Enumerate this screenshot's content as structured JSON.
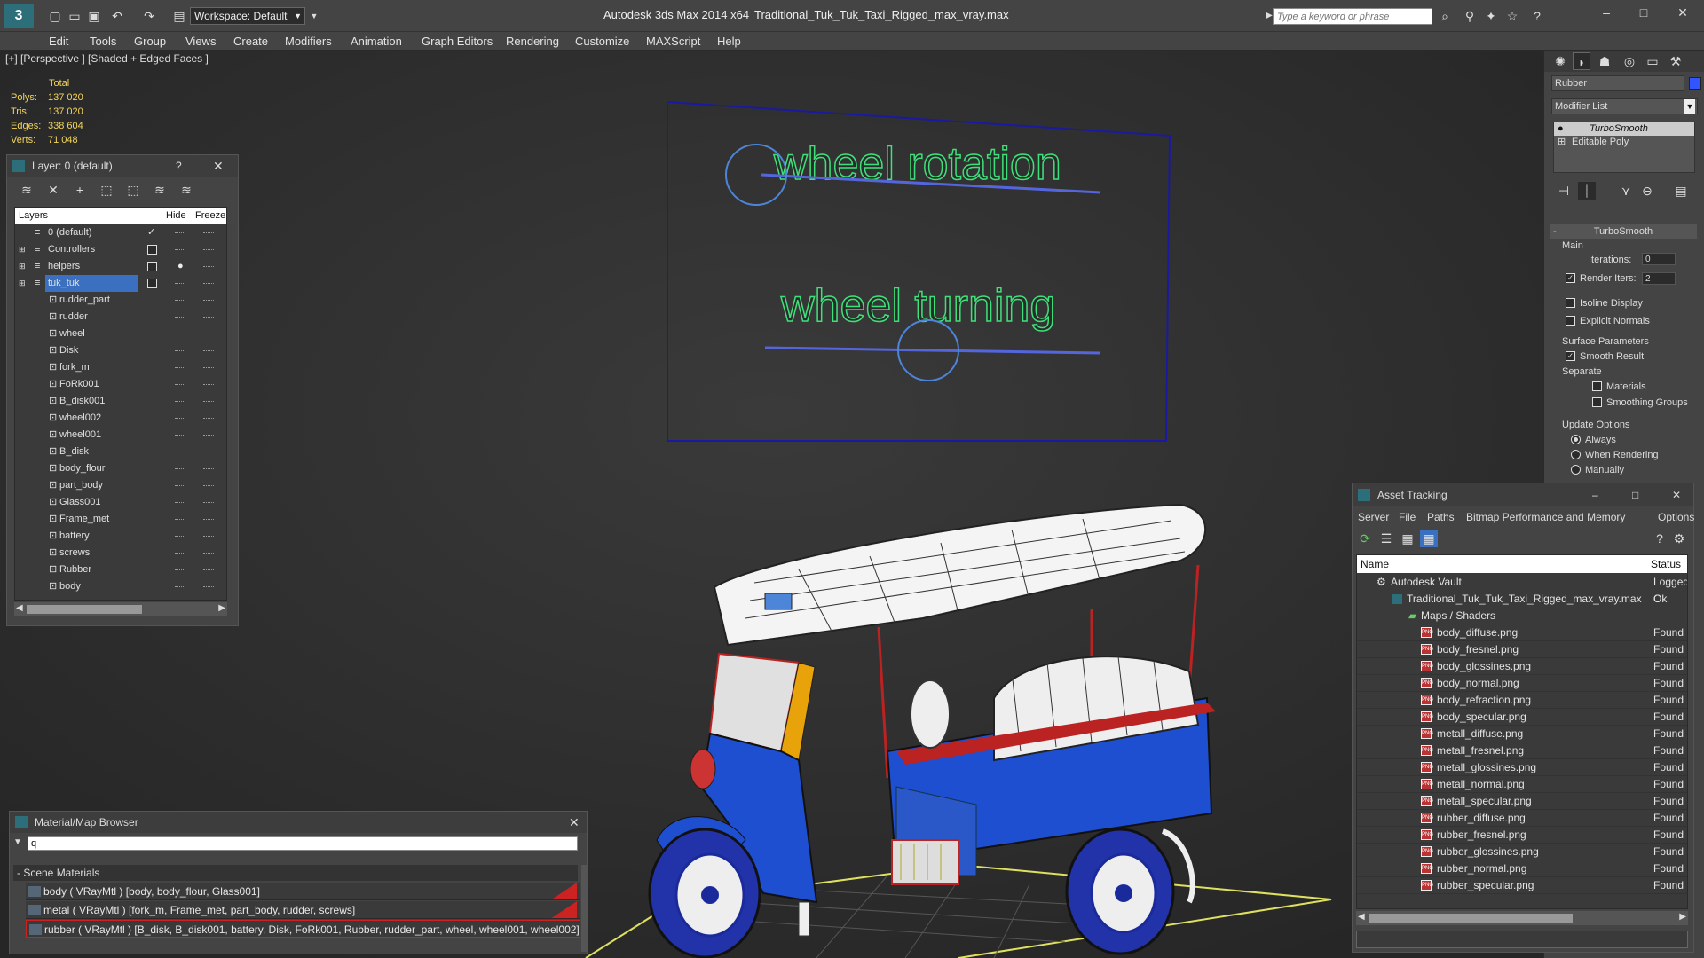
{
  "window": {
    "app_title": "Autodesk 3ds Max  2014 x64",
    "file_title": "Traditional_Tuk_Tuk_Taxi_Rigged_max_vray.max",
    "workspace": "Workspace: Default",
    "search_placeholder": "Type a keyword or phrase"
  },
  "menu": [
    "Edit",
    "Tools",
    "Group",
    "Views",
    "Create",
    "Modifiers",
    "Animation",
    "Graph Editors",
    "Rendering",
    "Customize",
    "MAXScript",
    "Help"
  ],
  "viewport": {
    "label": "[+] [Perspective ] [Shaded + Edged Faces ]",
    "stats": {
      "header": "Total",
      "rows": [
        {
          "k": "Polys:",
          "v": "137 020"
        },
        {
          "k": "Tris:",
          "v": "137 020"
        },
        {
          "k": "Edges:",
          "v": "338 604"
        },
        {
          "k": "Verts:",
          "v": "71 048"
        }
      ]
    },
    "rig_text_1": "wheel rotation",
    "rig_text_2": "wheel turning",
    "rig_color": "#3fe07a",
    "control_color": "#5566dd"
  },
  "layer_panel": {
    "title": "Layer: 0 (default)",
    "help": "?",
    "col_layers": "Layers",
    "col_hide": "Hide",
    "col_freeze": "Freeze",
    "layers": [
      {
        "name": "0 (default)",
        "level": 0,
        "active": true
      },
      {
        "name": "Controllers",
        "level": 0
      },
      {
        "name": "helpers",
        "level": 0
      },
      {
        "name": "tuk_tuk",
        "level": 0,
        "selected": true
      }
    ],
    "objects": [
      "rudder_part",
      "rudder",
      "wheel",
      "Disk",
      "fork_m",
      "FoRk001",
      "B_disk001",
      "wheel002",
      "wheel001",
      "B_disk",
      "body_flour",
      "part_body",
      "Glass001",
      "Frame_met",
      "battery",
      "screws",
      "Rubber",
      "body"
    ]
  },
  "material_browser": {
    "title": "Material/Map Browser",
    "search_value": "q",
    "section": "- Scene Materials",
    "items": [
      "body  ( VRayMtl ) [body, body_flour, Glass001]",
      "metal  ( VRayMtl ) [fork_m, Frame_met, part_body, rudder, screws]",
      "rubber  ( VRayMtl ) [B_disk, B_disk001, battery, Disk, FoRk001, Rubber, rudder_part, wheel, wheel001, wheel002]"
    ]
  },
  "command_panel": {
    "object_name": "Rubber",
    "modifier_list": "Modifier List",
    "stack": [
      "TurboSmooth",
      "Editable Poly"
    ],
    "rollout": "TurboSmooth",
    "main": "Main",
    "iterations_label": "Iterations:",
    "iterations_value": "0",
    "render_iters_label": "Render Iters:",
    "render_iters_value": "2",
    "isoline": "Isoline Display",
    "explicit": "Explicit Normals",
    "surface": "Surface Parameters",
    "smooth_result": "Smooth Result",
    "separate": "Separate",
    "materials": "Materials",
    "smoothing_groups": "Smoothing Groups",
    "update_options": "Update Options",
    "always": "Always",
    "when_rendering": "When Rendering",
    "manually": "Manually",
    "accent": "#3355ff"
  },
  "asset_tracking": {
    "title": "Asset Tracking",
    "menu": [
      "Server",
      "File",
      "Paths",
      "Bitmap Performance and Memory",
      "Options"
    ],
    "col_name": "Name",
    "col_status": "Status",
    "vault": {
      "name": "Autodesk Vault",
      "status": "Logged C"
    },
    "file": {
      "name": "Traditional_Tuk_Tuk_Taxi_Rigged_max_vray.max",
      "status": "Ok"
    },
    "folder": "Maps / Shaders",
    "maps": [
      {
        "name": "body_diffuse.png",
        "status": "Found"
      },
      {
        "name": "body_fresnel.png",
        "status": "Found"
      },
      {
        "name": "body_glossines.png",
        "status": "Found"
      },
      {
        "name": "body_normal.png",
        "status": "Found"
      },
      {
        "name": "body_refraction.png",
        "status": "Found"
      },
      {
        "name": "body_specular.png",
        "status": "Found"
      },
      {
        "name": "metall_diffuse.png",
        "status": "Found"
      },
      {
        "name": "metall_fresnel.png",
        "status": "Found"
      },
      {
        "name": "metall_glossines.png",
        "status": "Found"
      },
      {
        "name": "metall_normal.png",
        "status": "Found"
      },
      {
        "name": "metall_specular.png",
        "status": "Found"
      },
      {
        "name": "rubber_diffuse.png",
        "status": "Found"
      },
      {
        "name": "rubber_fresnel.png",
        "status": "Found"
      },
      {
        "name": "rubber_glossines.png",
        "status": "Found"
      },
      {
        "name": "rubber_normal.png",
        "status": "Found"
      },
      {
        "name": "rubber_specular.png",
        "status": "Found"
      }
    ]
  }
}
